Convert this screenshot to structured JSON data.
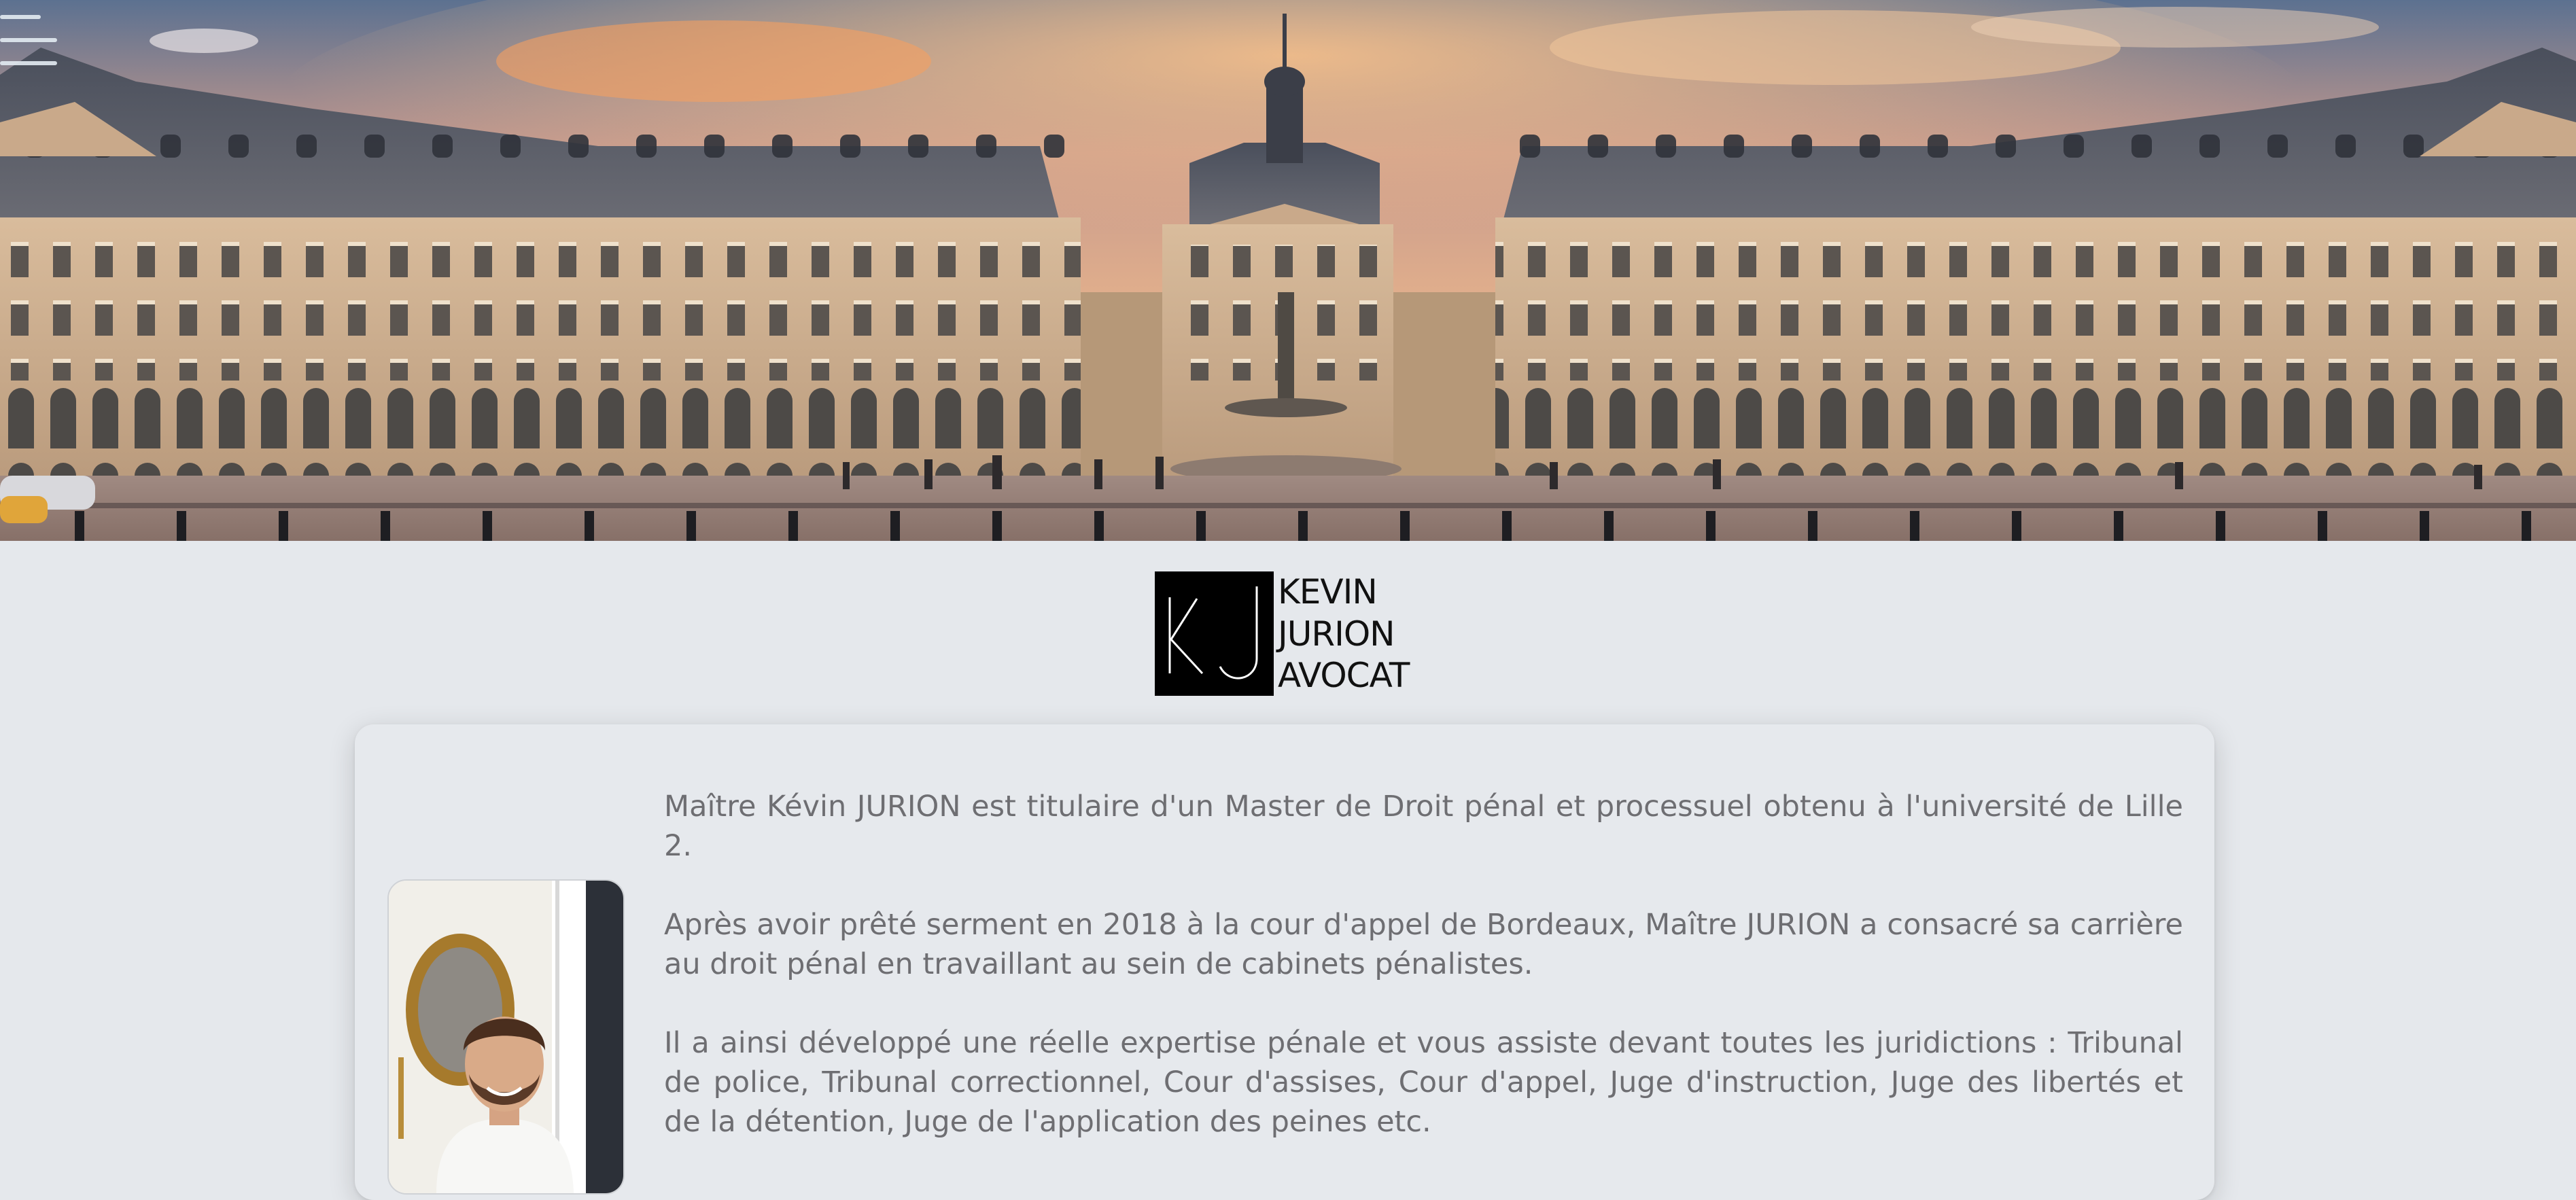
{
  "menu": {
    "icon": "hamburger-menu-icon"
  },
  "hero": {
    "image": "Place de la Bourse, Bordeaux at sunset"
  },
  "logo": {
    "monogram": "KJ",
    "lines": [
      "KEVIN",
      "JURION",
      "AVOCAT"
    ]
  },
  "about": {
    "photo": "Portrait of Maître Kévin Jurion",
    "paragraphs": [
      "Maître Kévin JURION est titulaire d'un Master de Droit pénal et processuel obtenu à l'université de Lille 2.",
      "Après avoir prêté serment en 2018 à la cour d'appel de Bordeaux, Maître JURION a consacré sa carrière au droit pénal en travaillant au sein de cabinets pénalistes.",
      "Il a ainsi développé une réelle expertise pénale et vous assiste devant toutes les juridictions : Tribunal de police, Tribunal correctionnel, Cour d'assises, Cour d'appel, Juge d'instruction, Juge des libertés et de la détention, Juge de l'application des peines etc."
    ]
  },
  "colors": {
    "page_background": "#e5e8ec",
    "text": "#6e6e72",
    "logo_block": "#000000"
  }
}
